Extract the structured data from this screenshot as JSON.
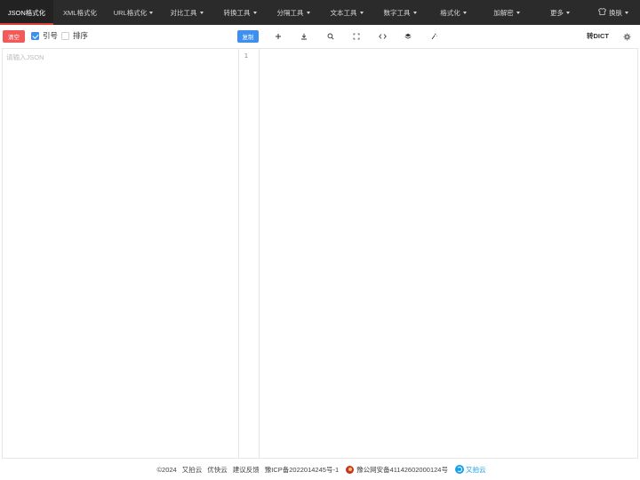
{
  "nav": {
    "items": [
      {
        "label": "JSON格式化",
        "dropdown": false
      },
      {
        "label": "XML格式化",
        "dropdown": false
      },
      {
        "label": "URL格式化",
        "dropdown": true
      },
      {
        "label": "对比工具",
        "dropdown": true
      },
      {
        "label": "转换工具",
        "dropdown": true
      },
      {
        "label": "分隔工具",
        "dropdown": true
      },
      {
        "label": "文本工具",
        "dropdown": true
      },
      {
        "label": "数字工具",
        "dropdown": true
      },
      {
        "label": "格式化",
        "dropdown": true
      },
      {
        "label": "加解密",
        "dropdown": true
      },
      {
        "label": "更多",
        "dropdown": true
      }
    ],
    "skin": {
      "icon": "shirt-icon",
      "label": "换肤"
    }
  },
  "toolbar": {
    "clear_label": "清空",
    "quotes": {
      "label": "引号",
      "checked": true
    },
    "sort": {
      "label": "排序",
      "checked": false
    },
    "copy_label": "复制",
    "tools": [
      "plus-icon",
      "download-icon",
      "search-icon",
      "fullscreen-icon",
      "code-icon",
      "layers-icon",
      "magic-icon"
    ],
    "to_dict_label": "转DICT",
    "settings_icon": "gear-icon"
  },
  "editor": {
    "placeholder": "请输入JSON",
    "line_number": "1"
  },
  "footer": {
    "copyright": "©2024",
    "links": [
      "又拍云",
      "优快云",
      "建议反馈"
    ],
    "icp": "豫ICP备2022014245号-1",
    "police": "豫公网安备41142602000124号",
    "sponsor": "又拍云"
  },
  "colors": {
    "nav_bg": "#2b2b2b",
    "active_underline": "#d9403a",
    "clear_button": "#f25a5a",
    "primary_blue": "#3d8ff0",
    "sponsor_blue": "#1aa0e8"
  }
}
